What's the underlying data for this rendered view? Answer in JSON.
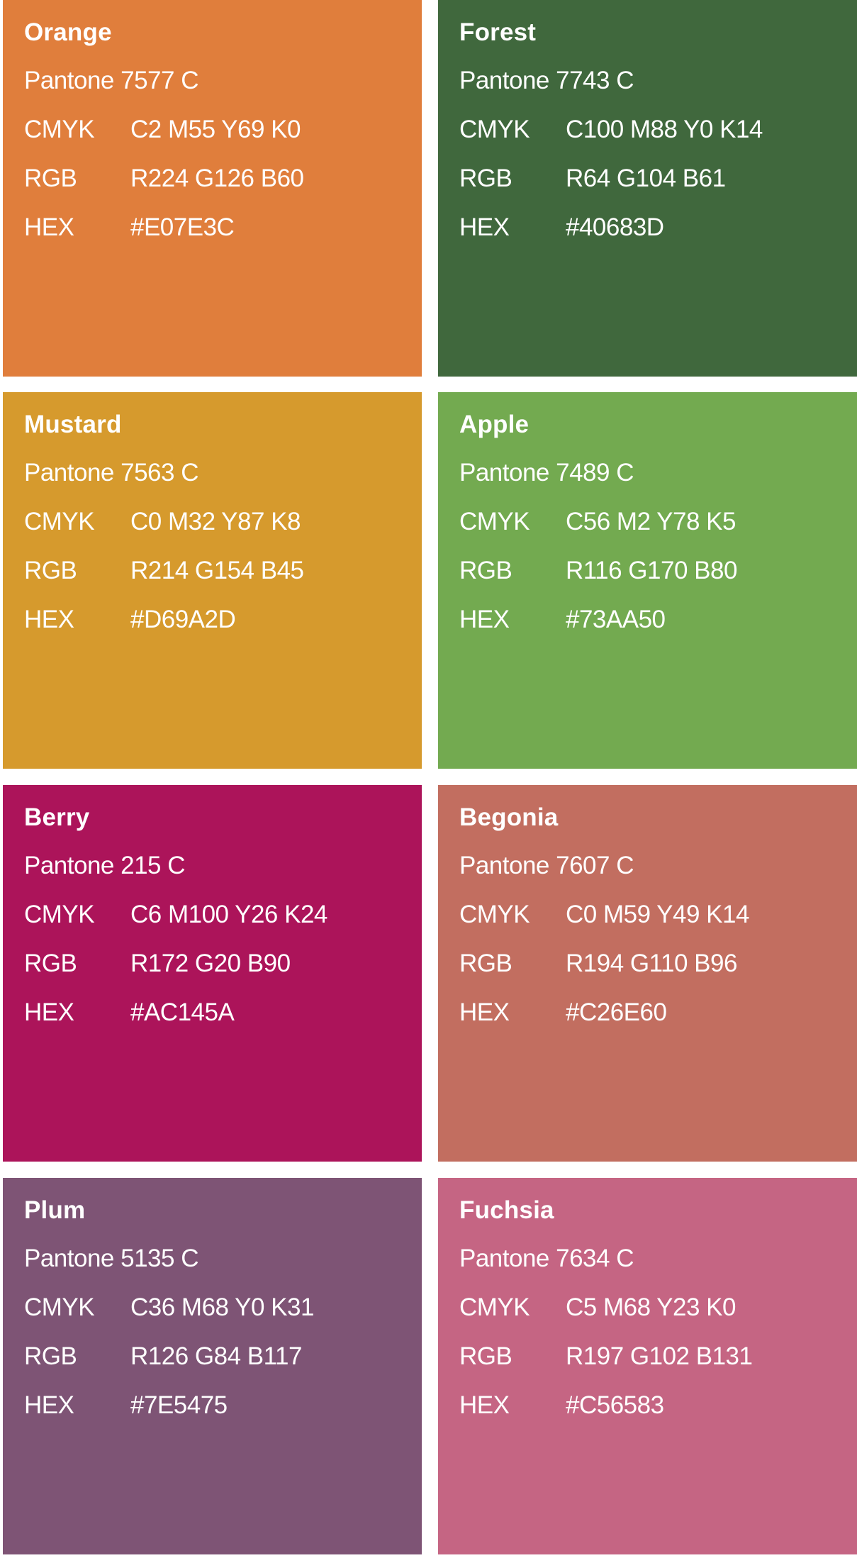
{
  "labels": {
    "cmyk": "CMYK",
    "rgb": "RGB",
    "hex": "HEX"
  },
  "swatches": [
    {
      "name": "Orange",
      "pantone": "Pantone 7577 C",
      "cmyk": "C2 M55 Y69 K0",
      "rgb": "R224 G126 B60",
      "hex": "#E07E3C",
      "color": "#E07E3C"
    },
    {
      "name": "Forest",
      "pantone": "Pantone 7743 C",
      "cmyk": "C100 M88 Y0 K14",
      "rgb": "R64 G104 B61",
      "hex": "#40683D",
      "color": "#40683D"
    },
    {
      "name": "Mustard",
      "pantone": "Pantone 7563 C",
      "cmyk": "C0 M32 Y87 K8",
      "rgb": "R214 G154 B45",
      "hex": "#D69A2D",
      "color": "#D69A2D"
    },
    {
      "name": "Apple",
      "pantone": "Pantone 7489 C",
      "cmyk": "C56 M2 Y78 K5",
      "rgb": "R116 G170 B80",
      "hex": "#73AA50",
      "color": "#73AA50"
    },
    {
      "name": "Berry",
      "pantone": "Pantone 215 C",
      "cmyk": "C6 M100 Y26 K24",
      "rgb": "R172 G20 B90",
      "hex": "#AC145A",
      "color": "#AC145A"
    },
    {
      "name": "Begonia",
      "pantone": "Pantone 7607 C",
      "cmyk": "C0 M59 Y49 K14",
      "rgb": "R194 G110 B96",
      "hex": "#C26E60",
      "color": "#C26E60"
    },
    {
      "name": "Plum",
      "pantone": "Pantone 5135 C",
      "cmyk": "C36 M68 Y0 K31",
      "rgb": "R126 G84 B117",
      "hex": "#7E5475",
      "color": "#7E5475"
    },
    {
      "name": "Fuchsia",
      "pantone": "Pantone 7634 C",
      "cmyk": "C5 M68 Y23 K0",
      "rgb": "R197 G102 B131",
      "hex": "#C56583",
      "color": "#C56583"
    }
  ]
}
